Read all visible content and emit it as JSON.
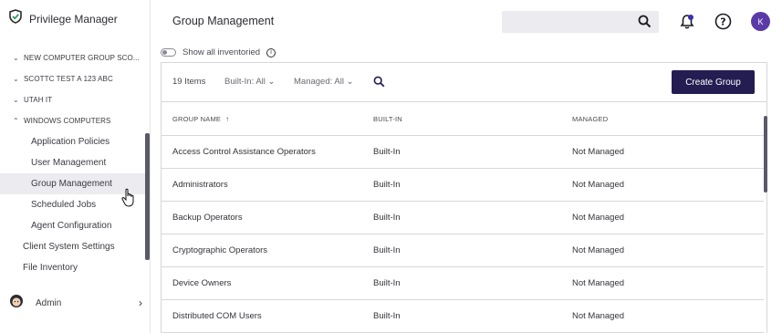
{
  "app": {
    "name": "Privilege Manager"
  },
  "sidebar": {
    "groups": [
      {
        "label": "NEW COMPUTER GROUP SCO...",
        "expanded": false
      },
      {
        "label": "SCOTTC TEST A 123 ABC",
        "expanded": false
      },
      {
        "label": "UTAH IT",
        "expanded": false
      },
      {
        "label": "WINDOWS COMPUTERS",
        "expanded": true
      }
    ],
    "sub_items": [
      {
        "label": "Application Policies"
      },
      {
        "label": "User Management"
      },
      {
        "label": "Group Management",
        "active": true
      },
      {
        "label": "Scheduled Jobs"
      },
      {
        "label": "Agent Configuration"
      }
    ],
    "top_items": [
      {
        "label": "Client System Settings"
      },
      {
        "label": "File Inventory"
      }
    ],
    "admin_label": "Admin"
  },
  "header": {
    "title": "Group Management",
    "search_placeholder": "",
    "avatar_initial": "K"
  },
  "toggle": {
    "label": "Show all inventoried",
    "on": false
  },
  "toolbar": {
    "count": "19 Items",
    "built_in_filter": "Built-In: All",
    "managed_filter": "Managed: All",
    "create_label": "Create Group"
  },
  "table": {
    "columns": [
      "GROUP NAME",
      "BUILT-IN",
      "MANAGED"
    ],
    "rows": [
      [
        "Access Control Assistance Operators",
        "Built-In",
        "Not Managed"
      ],
      [
        "Administrators",
        "Built-In",
        "Not Managed"
      ],
      [
        "Backup Operators",
        "Built-In",
        "Not Managed"
      ],
      [
        "Cryptographic Operators",
        "Built-In",
        "Not Managed"
      ],
      [
        "Device Owners",
        "Built-In",
        "Not Managed"
      ],
      [
        "Distributed COM Users",
        "Built-In",
        "Not Managed"
      ]
    ]
  },
  "colors": {
    "accent": "#231d52",
    "avatar": "#5b3aa8",
    "brand_green": "#2e9e5a"
  }
}
